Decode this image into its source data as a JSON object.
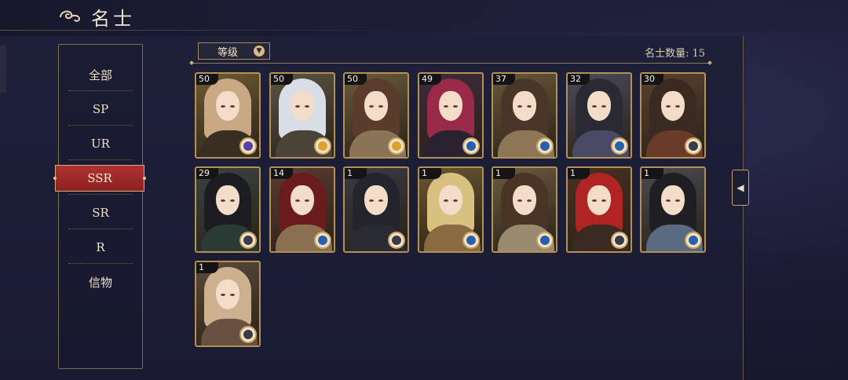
{
  "header": {
    "title": "名士"
  },
  "sidebar": {
    "items": [
      {
        "label": "全部"
      },
      {
        "label": "SP"
      },
      {
        "label": "UR"
      },
      {
        "label": "SSR"
      },
      {
        "label": "SR"
      },
      {
        "label": "R"
      },
      {
        "label": "信物"
      }
    ],
    "active": "SSR"
  },
  "sort": {
    "label": "等级"
  },
  "count": {
    "label": "名士数量:",
    "value": "15"
  },
  "cards": [
    {
      "level": "50",
      "hair": "#c9a884",
      "outfit": "#3a2e22",
      "bg": "#6e5a33",
      "badge": "#5b3fa8"
    },
    {
      "level": "50",
      "hair": "#d9dde6",
      "outfit": "#4a4438",
      "bg": "#5a5444",
      "badge": "#e0a030"
    },
    {
      "level": "50",
      "hair": "#5b3b2a",
      "outfit": "#8a7458",
      "bg": "#6b5a3a",
      "badge": "#e0a030"
    },
    {
      "level": "49",
      "hair": "#9a2a4a",
      "outfit": "#2a2230",
      "bg": "#3e2a3e",
      "badge": "#2a5fae"
    },
    {
      "level": "37",
      "hair": "#4a3628",
      "outfit": "#8c7656",
      "bg": "#6a5638",
      "badge": "#2a5fae"
    },
    {
      "level": "32",
      "hair": "#2a2a34",
      "outfit": "#4a4a66",
      "bg": "#4a4a5c",
      "badge": "#2a5fae"
    },
    {
      "level": "30",
      "hair": "#3a2a22",
      "outfit": "#6a3a2a",
      "bg": "#5a4030",
      "badge": "#3a3a4a"
    },
    {
      "level": "29",
      "hair": "#1c1c22",
      "outfit": "#2a3a34",
      "bg": "#3a4440",
      "badge": "#3a3a4a"
    },
    {
      "level": "14",
      "hair": "#6a1c1c",
      "outfit": "#8a7050",
      "bg": "#5a3a30",
      "badge": "#2a5fae"
    },
    {
      "level": "1",
      "hair": "#24242c",
      "outfit": "#2a2a34",
      "bg": "#3a3a44",
      "badge": "#3a3a4a"
    },
    {
      "level": "1",
      "hair": "#d8c080",
      "outfit": "#8a6a40",
      "bg": "#6a5630",
      "badge": "#2a5fae"
    },
    {
      "level": "1",
      "hair": "#4a3426",
      "outfit": "#9a8a70",
      "bg": "#6a5a40",
      "badge": "#2a5fae"
    },
    {
      "level": "1",
      "hair": "#b02424",
      "outfit": "#3a2a22",
      "bg": "#4a3022",
      "badge": "#3a3a4a"
    },
    {
      "level": "1",
      "hair": "#1e1e24",
      "outfit": "#5a6a80",
      "bg": "#4a4a50",
      "badge": "#2a5fae"
    },
    {
      "level": "1",
      "hair": "#cdb08e",
      "outfit": "#6a5040",
      "bg": "#5a4a3a",
      "badge": "#3a3a4a"
    }
  ]
}
